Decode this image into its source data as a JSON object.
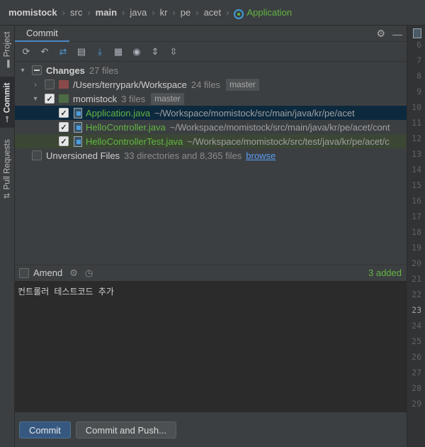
{
  "breadcrumb": [
    "momistock",
    "src",
    "main",
    "java",
    "kr",
    "pe",
    "acet",
    "Application"
  ],
  "side_tabs": {
    "project": "Project",
    "commit": "Commit",
    "pull_requests": "Pull Requests"
  },
  "panel": {
    "tab": "Commit"
  },
  "tree": {
    "changes_label": "Changes",
    "changes_count": "27 files",
    "repo1_path": "/Users/terrypark/Workspace",
    "repo1_count": "24 files",
    "repo1_branch": "master",
    "repo2_name": "momistock",
    "repo2_count": "3 files",
    "repo2_branch": "master",
    "files": [
      {
        "name": "Application.java",
        "path": "~/Workspace/momistock/src/main/java/kr/pe/acet"
      },
      {
        "name": "HelloController.java",
        "path": "~/Workspace/momistock/src/main/java/kr/pe/acet/cont"
      },
      {
        "name": "HelloControllerTest.java",
        "path": "~/Workspace/momistock/src/test/java/kr/pe/acet/c"
      }
    ],
    "unversioned_label": "Unversioned Files",
    "unversioned_count": "33 directories and 8,365 files",
    "browse_link": "browse"
  },
  "amend": {
    "label": "Amend",
    "added": "3 added"
  },
  "commit_message": "컨트롤러 테스트코드 추가",
  "buttons": {
    "commit": "Commit",
    "commit_push": "Commit and Push..."
  },
  "gutter_lines": [
    "6",
    "7",
    "8",
    "9",
    "10",
    "11",
    "12",
    "13",
    "14",
    "15",
    "16",
    "17",
    "18",
    "19",
    "20",
    "21",
    "22",
    "23",
    "24",
    "25",
    "26",
    "27",
    "28",
    "29"
  ],
  "current_line": "23"
}
